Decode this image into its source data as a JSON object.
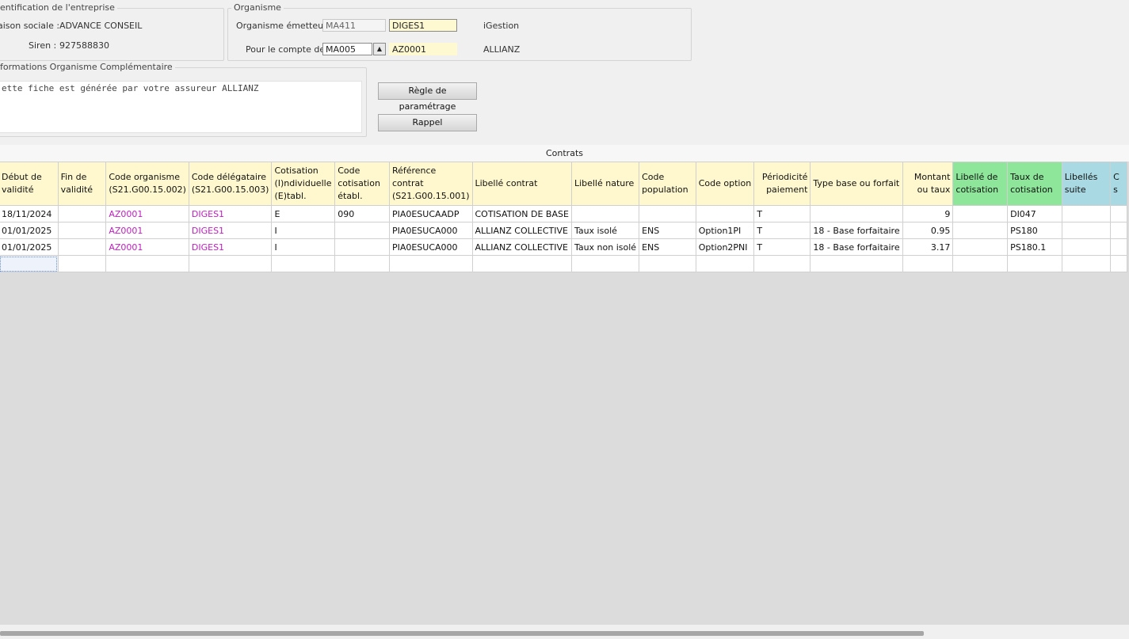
{
  "company": {
    "legend": "entification de l'entreprise",
    "raison_label": "aison sociale :",
    "raison_value": "ADVANCE CONSEIL",
    "siren_label": "Siren :",
    "siren_value": "927588830"
  },
  "organisme": {
    "legend": "Organisme",
    "emetteur_label": "Organisme émetteur :",
    "emetteur_code": "MA411",
    "emetteur_value": "DIGES1",
    "emetteur_name": "iGestion",
    "compte_label": "Pour le compte de :",
    "compte_code": "MA005",
    "compte_value": "AZ0001",
    "compte_name": "ALLIANZ"
  },
  "info": {
    "legend": "formations Organisme Complémentaire",
    "text": "ette fiche est générée par votre assureur ALLIANZ"
  },
  "buttons": {
    "regle": "Règle de paramétrage",
    "rappel": "Rappel"
  },
  "grid": {
    "title": "Contrats",
    "headers": [
      "Début de validité",
      "Fin de validité",
      "Code organisme (S21.G00.15.002)",
      "Code délégataire (S21.G00.15.003)",
      "Cotisation (I)ndividuelle (E)tabl.",
      "Code cotisation établ.",
      "Référence contrat (S21.G00.15.001)",
      "Libellé contrat",
      "Libellé nature",
      "Code population",
      "Code option",
      "Périodicité paiement",
      "Type base ou forfait",
      "Montant ou taux",
      "Libellé de cotisation",
      "Taux de cotisation",
      "Libellés suite",
      "C s"
    ],
    "rows": [
      [
        "18/11/2024",
        "",
        "AZ0001",
        "DIGES1",
        "E",
        "090",
        "PIA0ESUCAADP",
        "COTISATION DE BASE",
        "",
        "",
        "",
        "T",
        "",
        "9",
        "",
        "DI047",
        "",
        ""
      ],
      [
        "01/01/2025",
        "",
        "AZ0001",
        "DIGES1",
        "I",
        "",
        "PIA0ESUCA000",
        "ALLIANZ COLLECTIVE",
        "Taux isolé",
        "ENS",
        "Option1PI",
        "T",
        "18 - Base forfaitaire",
        "0.95",
        "",
        "PS180",
        "",
        ""
      ],
      [
        "01/01/2025",
        "",
        "AZ0001",
        "DIGES1",
        "I",
        "",
        "PIA0ESUCA000",
        "ALLIANZ COLLECTIVE",
        "Taux non isolé",
        "ENS",
        "Option2PNI",
        "T",
        "18 - Base forfaitaire",
        "3.17",
        "",
        "PS180.1",
        "",
        ""
      ],
      [
        "",
        "",
        "",
        "",
        "",
        "",
        "",
        "",
        "",
        "",
        "",
        "",
        "",
        "",
        "",
        "",
        "",
        ""
      ]
    ]
  }
}
